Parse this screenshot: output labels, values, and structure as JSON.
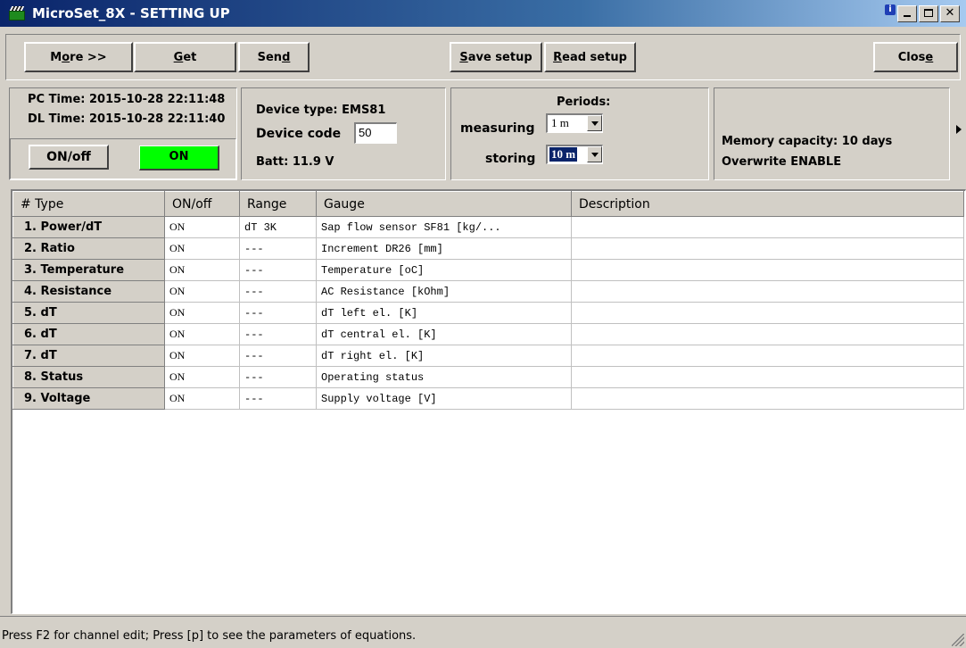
{
  "window": {
    "title": "MicroSet_8X - SETTING UP",
    "info_glyph": "i"
  },
  "toolbar": {
    "more": {
      "pre": "M",
      "ul": "o",
      "post": "re >>"
    },
    "get": {
      "pre": "",
      "ul": "G",
      "post": "et"
    },
    "send": {
      "pre": "Sen",
      "ul": "d",
      "post": ""
    },
    "save_setup": {
      "pre": "",
      "ul": "S",
      "post": "ave setup"
    },
    "read_setup": {
      "pre": "",
      "ul": "R",
      "post": "ead setup"
    },
    "close": {
      "pre": "Clos",
      "ul": "e",
      "post": ""
    }
  },
  "time_panel": {
    "pc_time": "PC Time: 2015-10-28 22:11:48",
    "dl_time": "DL Time: 2015-10-28 22:11:40",
    "onoff_label": "ON/off",
    "on_state": "ON"
  },
  "device_panel": {
    "device_type": "Device type: EMS81",
    "device_code_label": "Device code",
    "device_code_value": "50",
    "batt": "Batt: 11.9 V"
  },
  "periods_panel": {
    "title": "Periods:",
    "measuring_label": "measuring",
    "measuring_value": "1 m",
    "storing_label": "storing",
    "storing_value": "10 m"
  },
  "memory_panel": {
    "capacity": "Memory capacity: 10 days",
    "overwrite": "Overwrite ENABLE"
  },
  "table": {
    "headers": [
      "# Type",
      "ON/off",
      "Range",
      "Gauge",
      "Description"
    ],
    "rows": [
      {
        "type": "1. Power/dT",
        "onoff": "ON",
        "range": "dT 3K",
        "gauge": "Sap flow sensor SF81 [kg/...",
        "description": ""
      },
      {
        "type": "2. Ratio",
        "onoff": "ON",
        "range": "---",
        "gauge": "Increment DR26 [mm]",
        "description": ""
      },
      {
        "type": "3. Temperature",
        "onoff": "ON",
        "range": "---",
        "gauge": "Temperature [oC]",
        "description": ""
      },
      {
        "type": "4. Resistance",
        "onoff": "ON",
        "range": "---",
        "gauge": "AC Resistance [kOhm]",
        "description": ""
      },
      {
        "type": "5. dT",
        "onoff": "ON",
        "range": "---",
        "gauge": "dT left el. [K]",
        "description": ""
      },
      {
        "type": "6. dT",
        "onoff": "ON",
        "range": "---",
        "gauge": "dT central el. [K]",
        "description": ""
      },
      {
        "type": "7. dT",
        "onoff": "ON",
        "range": "---",
        "gauge": "dT right el. [K]",
        "description": ""
      },
      {
        "type": "8. Status",
        "onoff": "ON",
        "range": "---",
        "gauge": "Operating status",
        "description": ""
      },
      {
        "type": "9. Voltage",
        "onoff": "ON",
        "range": "---",
        "gauge": "Supply voltage [V]",
        "description": ""
      }
    ]
  },
  "statusbar": {
    "text": "Press F2 for channel edit; Press [p] to see the parameters of equations."
  },
  "colors": {
    "on_indicator": "#00ff00",
    "selection": "#0a246a",
    "face": "#d4d0c8"
  }
}
